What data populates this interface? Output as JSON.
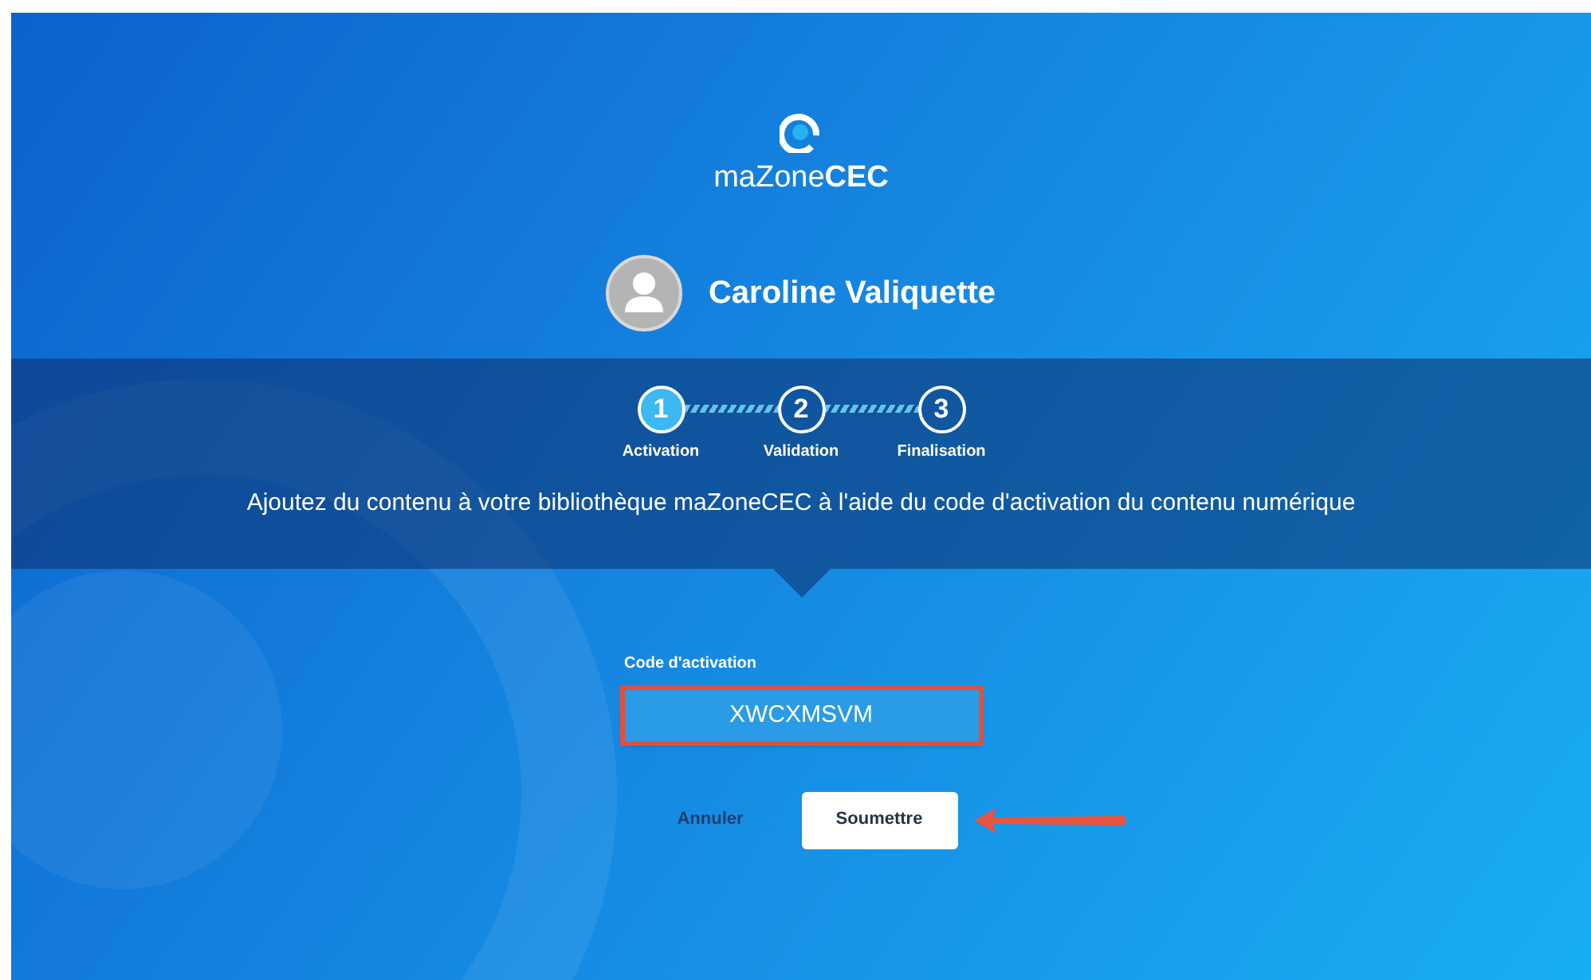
{
  "brand": {
    "prefix": "maZone",
    "suffix": "CEC"
  },
  "user": {
    "name": "Caroline Valiquette"
  },
  "steps": [
    {
      "number": "1",
      "label": "Activation",
      "selected": true
    },
    {
      "number": "2",
      "label": "Validation",
      "selected": false
    },
    {
      "number": "3",
      "label": "Finalisation",
      "selected": false
    }
  ],
  "description": "Ajoutez du contenu à votre bibliothèque maZoneCEC à l'aide du code d'activation du contenu numérique",
  "field": {
    "label": "Code d'activation",
    "value": "XWCXMSVM",
    "highlighted": true
  },
  "buttons": [
    {
      "label": "Annuler",
      "kind": "link",
      "pointed": false
    },
    {
      "label": "Soumettre",
      "kind": "primary",
      "pointed": true
    }
  ]
}
